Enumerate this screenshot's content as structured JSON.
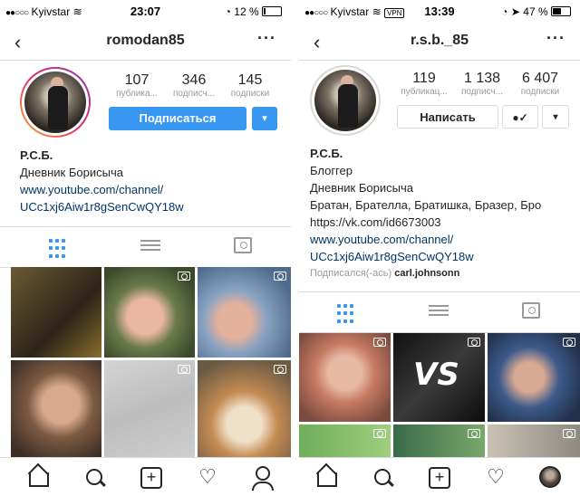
{
  "left": {
    "status": {
      "carrier": "Kyivstar",
      "time": "23:07",
      "battery": "12 %",
      "battery_level": 0.12
    },
    "nav": {
      "back": "‹",
      "username": "romodan85",
      "more": "···"
    },
    "stats": [
      {
        "num": "107",
        "label": "публика..."
      },
      {
        "num": "346",
        "label": "подписч..."
      },
      {
        "num": "145",
        "label": "подписки"
      }
    ],
    "follow_label": "Подписаться",
    "caret": "▾",
    "bio": {
      "name": "Р.С.Б.",
      "line1": "Дневник Борисыча",
      "link1": "www.youtube.com/channel/",
      "link2": "UCc1xj6Aiw1r8gSenCwQY18w"
    }
  },
  "right": {
    "status": {
      "carrier": "Kyivstar",
      "vpn": "VPN",
      "time": "13:39",
      "battery": "47 %",
      "battery_level": 0.47
    },
    "nav": {
      "back": "‹",
      "username": "r.s.b._85",
      "more": "···"
    },
    "stats": [
      {
        "num": "119",
        "label": "публикац..."
      },
      {
        "num": "1 138",
        "label": "подписч..."
      },
      {
        "num": "6 407",
        "label": "подписки"
      }
    ],
    "message_label": "Написать",
    "caret": "▾",
    "bio": {
      "name": "Р.С.Б.",
      "line1": "Блоггер",
      "line2": "Дневник Борисыча",
      "line3": "Братан, Брателла, Братишка, Бразер, Бро",
      "line4": "https://vk.com/id6673003",
      "link1": "www.youtube.com/channel/",
      "link2": "UCc1xj6Aiw1r8gSenCwQY18w",
      "followed_prefix": "Подписался(-ась)",
      "followed_user": "carl.johnsonn"
    },
    "vs_text": "VS"
  },
  "icons": {
    "grid": "grid-icon",
    "list": "list-icon",
    "tagged": "tagged-icon",
    "home": "home-icon",
    "search": "search-icon",
    "add": "add-icon",
    "heart": "heart-icon",
    "profile": "profile-icon"
  },
  "colors": {
    "accent": "#3897f0",
    "link": "#003569",
    "muted": "#999999",
    "border": "#dbdbdb"
  }
}
